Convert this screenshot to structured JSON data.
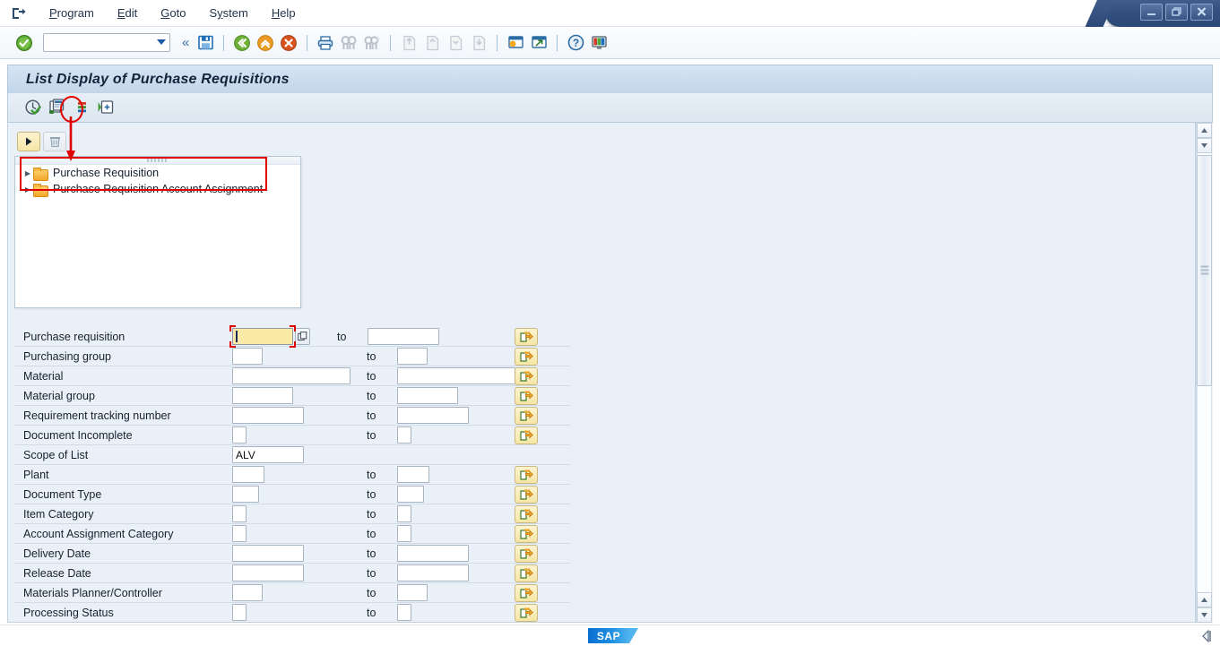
{
  "window": {
    "minimize_label": "—",
    "restore_label": "❐",
    "close_label": "✕"
  },
  "menubar": {
    "system_icon": "session-icon",
    "items": [
      {
        "label": "Program",
        "accel": "P"
      },
      {
        "label": "Edit",
        "accel": "E"
      },
      {
        "label": "Goto",
        "accel": "G"
      },
      {
        "label": "System",
        "accel": "y"
      },
      {
        "label": "Help",
        "accel": "H"
      }
    ]
  },
  "system_toolbar": {
    "enter_icon": "enter-check-icon",
    "command_field": {
      "value": "",
      "placeholder": ""
    },
    "command_collapse": "«",
    "icons": [
      {
        "name": "save-icon",
        "title": "Save"
      },
      {
        "name": "back-icon",
        "title": "Back"
      },
      {
        "name": "exit-icon",
        "title": "Exit"
      },
      {
        "name": "cancel-icon",
        "title": "Cancel"
      },
      {
        "name": "print-icon",
        "title": "Print"
      },
      {
        "name": "find-icon",
        "title": "Find"
      },
      {
        "name": "find-next-icon",
        "title": "Find Next"
      },
      {
        "name": "first-page-icon",
        "title": "First Page"
      },
      {
        "name": "previous-page-icon",
        "title": "Previous Page"
      },
      {
        "name": "next-page-icon",
        "title": "Next Page"
      },
      {
        "name": "last-page-icon",
        "title": "Last Page"
      },
      {
        "name": "create-session-icon",
        "title": "Create New Session"
      },
      {
        "name": "create-shortcut-icon",
        "title": "Create Shortcut"
      },
      {
        "name": "help-icon",
        "title": "Help"
      },
      {
        "name": "customize-layout-icon",
        "title": "Customize Local Layout"
      }
    ]
  },
  "title": {
    "text": "List Display of Purchase Requisitions"
  },
  "app_toolbar": {
    "icons": [
      {
        "name": "execute-icon",
        "title": "Execute"
      },
      {
        "name": "get-variant-icon",
        "title": "Get Variant"
      },
      {
        "name": "dynamic-selections-icon",
        "title": "Dynamic Selections",
        "highlighted": true
      },
      {
        "name": "multiple-selection-icon",
        "title": "Multiple Selection"
      }
    ]
  },
  "tree_toolbar": {
    "buttons": [
      {
        "name": "expand-selection-button",
        "glyph": "▶",
        "enabled": true
      },
      {
        "name": "delete-selection-button",
        "glyph": "trash",
        "enabled": false
      }
    ]
  },
  "dynamic_selection_tree": {
    "nodes": [
      {
        "label": "Purchase Requisition",
        "expanded": false
      },
      {
        "label": "Purchase Requisition Account Assignment",
        "expanded": false
      }
    ]
  },
  "annotations": {
    "highlight_color": "#e00000",
    "circled_toolbar_icon": "dynamic-selections-icon",
    "boxed_region": "dynamic-selection-tree"
  },
  "selection_form": {
    "to_label": "to",
    "multi_select_icon": "multiple-selection-arrow-icon",
    "matchcode_icon": "value-help-icon",
    "rows": [
      {
        "label": "Purchase requisition",
        "from": "",
        "from_size": "m",
        "focused": true,
        "has_matchcode": true,
        "to": "",
        "to_size": "l",
        "has_to": true,
        "has_multi": true
      },
      {
        "label": "Purchasing group",
        "from": "",
        "from_size": "s",
        "has_matchcode": false,
        "to": "",
        "to_size": "s",
        "has_to": true,
        "has_multi": true
      },
      {
        "label": "Material",
        "from": "",
        "from_size": "xl",
        "has_matchcode": false,
        "to": "",
        "to_size": "xl",
        "has_to": true,
        "has_multi": true
      },
      {
        "label": "Material group",
        "from": "",
        "from_size": "m",
        "has_matchcode": false,
        "to": "",
        "to_size": "m",
        "has_to": true,
        "has_multi": true
      },
      {
        "label": "Requirement tracking number",
        "from": "",
        "from_size": "l",
        "has_matchcode": false,
        "to": "",
        "to_size": "l",
        "has_to": true,
        "has_multi": true
      },
      {
        "label": "Document Incomplete",
        "from": "",
        "from_size": "xs",
        "has_matchcode": false,
        "to": "",
        "to_size": "xs",
        "has_to": true,
        "has_multi": true
      },
      {
        "label": "Scope of List",
        "from": "ALV",
        "from_size": "l",
        "has_matchcode": false,
        "to": "",
        "to_size": "",
        "has_to": false,
        "has_multi": false
      },
      {
        "label": "Plant",
        "from": "",
        "from_size": "s",
        "has_matchcode": false,
        "to": "",
        "to_size": "s",
        "has_to": true,
        "has_multi": true
      },
      {
        "label": "Document Type",
        "from": "",
        "from_size": "s",
        "has_matchcode": false,
        "to": "",
        "to_size": "s",
        "has_to": true,
        "has_multi": true
      },
      {
        "label": "Item Category",
        "from": "",
        "from_size": "xs",
        "has_matchcode": false,
        "to": "",
        "to_size": "xs",
        "has_to": true,
        "has_multi": true
      },
      {
        "label": "Account Assignment Category",
        "from": "",
        "from_size": "xs",
        "has_matchcode": false,
        "to": "",
        "to_size": "xs",
        "has_to": true,
        "has_multi": true
      },
      {
        "label": "Delivery Date",
        "from": "",
        "from_size": "l",
        "has_matchcode": false,
        "to": "",
        "to_size": "l",
        "has_to": true,
        "has_multi": true
      },
      {
        "label": "Release Date",
        "from": "",
        "from_size": "l",
        "has_matchcode": false,
        "to": "",
        "to_size": "l",
        "has_to": true,
        "has_multi": true
      },
      {
        "label": "Materials Planner/Controller",
        "from": "",
        "from_size": "s",
        "has_matchcode": false,
        "to": "",
        "to_size": "s",
        "has_to": true,
        "has_multi": true
      },
      {
        "label": "Processing Status",
        "from": "",
        "from_size": "xs",
        "has_matchcode": false,
        "to": "",
        "to_size": "xs",
        "has_to": true,
        "has_multi": true
      }
    ]
  },
  "status_bar": {
    "logo_text": "SAP",
    "resize_icon": "resize-grip-icon"
  }
}
